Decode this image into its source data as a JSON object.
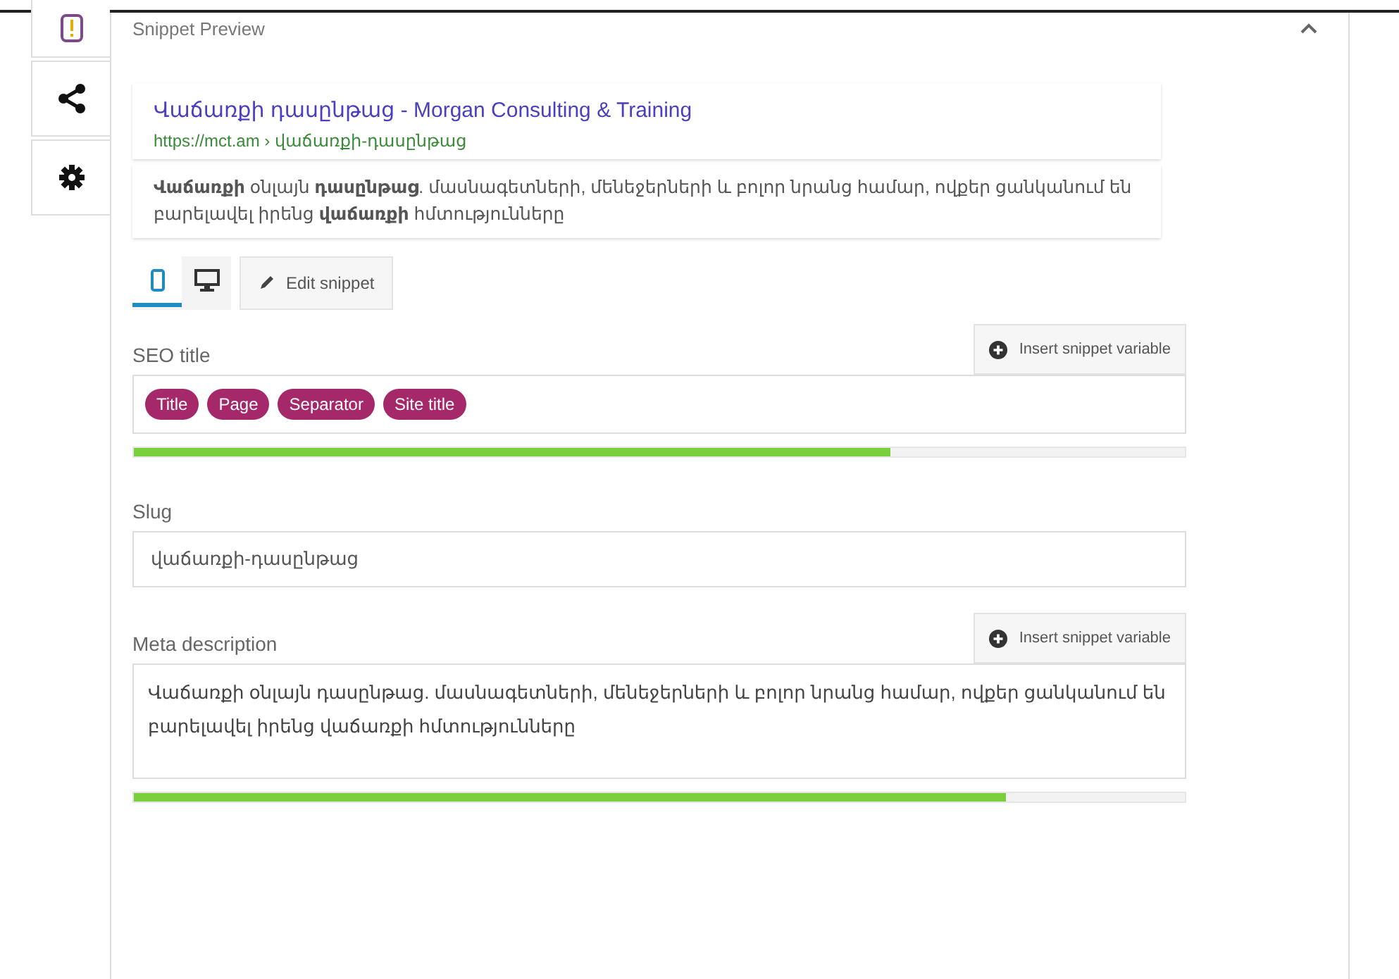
{
  "section": {
    "title": "Snippet Preview",
    "expanded": true
  },
  "sidebar": {
    "tabs": [
      {
        "kind": "traffic",
        "selected": false
      },
      {
        "kind": "share",
        "selected": false
      },
      {
        "kind": "gear",
        "selected": false
      }
    ]
  },
  "preview": {
    "title": "Վաճառքի դասընթաց - Morgan Consulting & Training",
    "url": "https://mct.am › վաճառքի-դասընթաց",
    "description": "**Վաճառքի** օնլայն **դասընթաց**. մասնագետների, մենեջերների և բոլոր նրանց համար, ովքեր ցանկանում են բարելավել իրենց **վաճառքի** հմտությունները"
  },
  "modes": [
    {
      "kind": "mobile",
      "selected": true
    },
    {
      "kind": "desktop",
      "selected": false
    }
  ],
  "edit_button": "Edit snippet",
  "seo_title": {
    "label": "SEO title",
    "button": "Insert snippet variable",
    "tags": [
      "Title",
      "Page",
      "Separator",
      "Site title"
    ],
    "level": 0.72
  },
  "slug": {
    "label": "Slug",
    "value": "վաճառքի-դասընթաց"
  },
  "meta": {
    "label": "Meta description",
    "button": "Insert snippet variable",
    "value": "Վաճառքի օնլայն դասընթաց. մասնագետների, մենեջերների և բոլոր նրանց համար, ովքեր ցանկանում են բարելավել իրենց վաճառքի հմտությունները",
    "level": 0.83
  }
}
